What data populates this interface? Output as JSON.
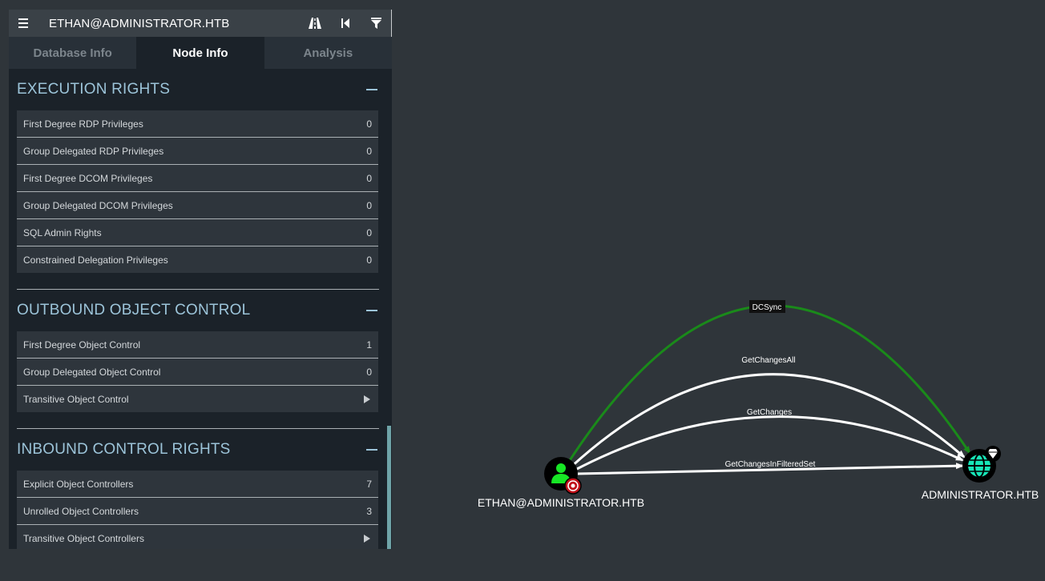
{
  "header": {
    "menu_icon": "hamburger-icon",
    "node_title": "ETHAN@ADMINISTRATOR.HTB",
    "path_icon": "road-icon",
    "back_icon": "skip-back-icon",
    "filter_icon": "filter-icon"
  },
  "tabs": [
    {
      "label": "Database Info"
    },
    {
      "label": "Node Info"
    },
    {
      "label": "Analysis"
    }
  ],
  "sections": {
    "execution": {
      "title": "EXECUTION RIGHTS",
      "rows": [
        {
          "label": "First Degree RDP Privileges",
          "value": "0"
        },
        {
          "label": "Group Delegated RDP Privileges",
          "value": "0"
        },
        {
          "label": "First Degree DCOM Privileges",
          "value": "0"
        },
        {
          "label": "Group Delegated DCOM Privileges",
          "value": "0"
        },
        {
          "label": "SQL Admin Rights",
          "value": "0"
        },
        {
          "label": "Constrained Delegation Privileges",
          "value": "0"
        }
      ]
    },
    "outbound": {
      "title": "OUTBOUND OBJECT CONTROL",
      "rows": [
        {
          "label": "First Degree Object Control",
          "value": "1"
        },
        {
          "label": "Group Delegated Object Control",
          "value": "0"
        },
        {
          "label": "Transitive Object Control"
        }
      ]
    },
    "inbound": {
      "title": "INBOUND CONTROL RIGHTS",
      "rows": [
        {
          "label": "Explicit Object Controllers",
          "value": "7"
        },
        {
          "label": "Unrolled Object Controllers",
          "value": "3"
        },
        {
          "label": "Transitive Object Controllers"
        }
      ]
    }
  },
  "graph": {
    "source_node": "ETHAN@ADMINISTRATOR.HTB",
    "target_node": "ADMINISTRATOR.HTB",
    "edges": [
      "DCSync",
      "GetChangesAll",
      "GetChanges",
      "GetChangesInFilteredSet"
    ],
    "colors": {
      "background": "#2f353a",
      "dcsync_edge": "#1a8a1a",
      "edge": "#ffffff",
      "user_node": "#17e625",
      "domain_node": "#17e6b8",
      "target_badge": "#c0101a"
    }
  }
}
